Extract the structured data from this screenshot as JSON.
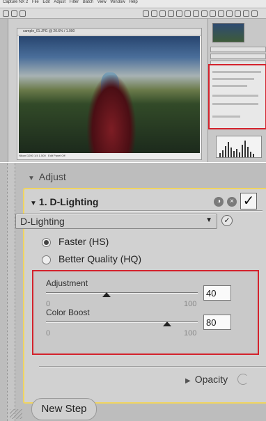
{
  "thumbnail": {
    "app_title": "Capture NX 2",
    "menu": [
      "File",
      "Edit",
      "Adjust",
      "Filter",
      "Batch",
      "View",
      "Window",
      "Help"
    ],
    "doc_title": "sample_01.JPG @ 20.6% / 1.000",
    "status": "Nikon D200 1/4 1.500",
    "status2": "Edit Panel Off"
  },
  "adjust": {
    "section_label": "Adjust"
  },
  "step": {
    "title": "1. D-Lighting",
    "dropdown_value": "D-Lighting",
    "radio_faster": "Faster (HS)",
    "radio_better": "Better Quality (HQ)",
    "radio_selected": "faster"
  },
  "sliders": {
    "adjustment": {
      "label": "Adjustment",
      "min": "0",
      "max": "100",
      "value": "40",
      "level": 40
    },
    "color_boost": {
      "label": "Color Boost",
      "min": "0",
      "max": "100",
      "value": "80",
      "level": 80
    }
  },
  "footer": {
    "opacity_label": "Opacity",
    "new_step_label": "New Step"
  },
  "colors": {
    "highlight": "#d4222c",
    "step_border": "#f0d460"
  }
}
